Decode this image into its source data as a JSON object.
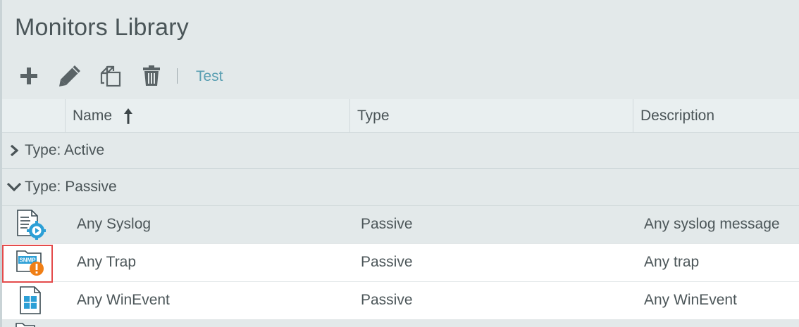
{
  "page": {
    "title": "Monitors Library"
  },
  "toolbar": {
    "buttons": [
      {
        "id": "add",
        "icon": "plus-icon"
      },
      {
        "id": "edit",
        "icon": "pencil-icon"
      },
      {
        "id": "copy",
        "icon": "copy-icon"
      },
      {
        "id": "delete",
        "icon": "trash-icon"
      }
    ],
    "test_label": "Test"
  },
  "grid": {
    "columns": [
      {
        "label": "Name",
        "sort": "ascending"
      },
      {
        "label": "Type"
      },
      {
        "label": "Description"
      }
    ],
    "groups": [
      {
        "label": "Type: Active",
        "expanded": false
      },
      {
        "label": "Type: Passive",
        "expanded": true
      }
    ],
    "rows": [
      {
        "icon": "syslog-monitor-icon",
        "name": "Any Syslog",
        "type": "Passive",
        "description": "Any syslog message"
      },
      {
        "icon": "snmp-trap-monitor-icon",
        "icon_text": "SNMP",
        "name": "Any Trap",
        "type": "Passive",
        "description": "Any trap"
      },
      {
        "icon": "winevent-monitor-icon",
        "name": "Any WinEvent",
        "type": "Passive",
        "description": "Any WinEvent"
      }
    ]
  },
  "colors": {
    "accent": "#5a9fb2",
    "highlight": "#e44b4b",
    "icon_blue": "#2c9fd6",
    "icon_orange": "#f07f16",
    "toolbar_icon": "#5a6366"
  }
}
